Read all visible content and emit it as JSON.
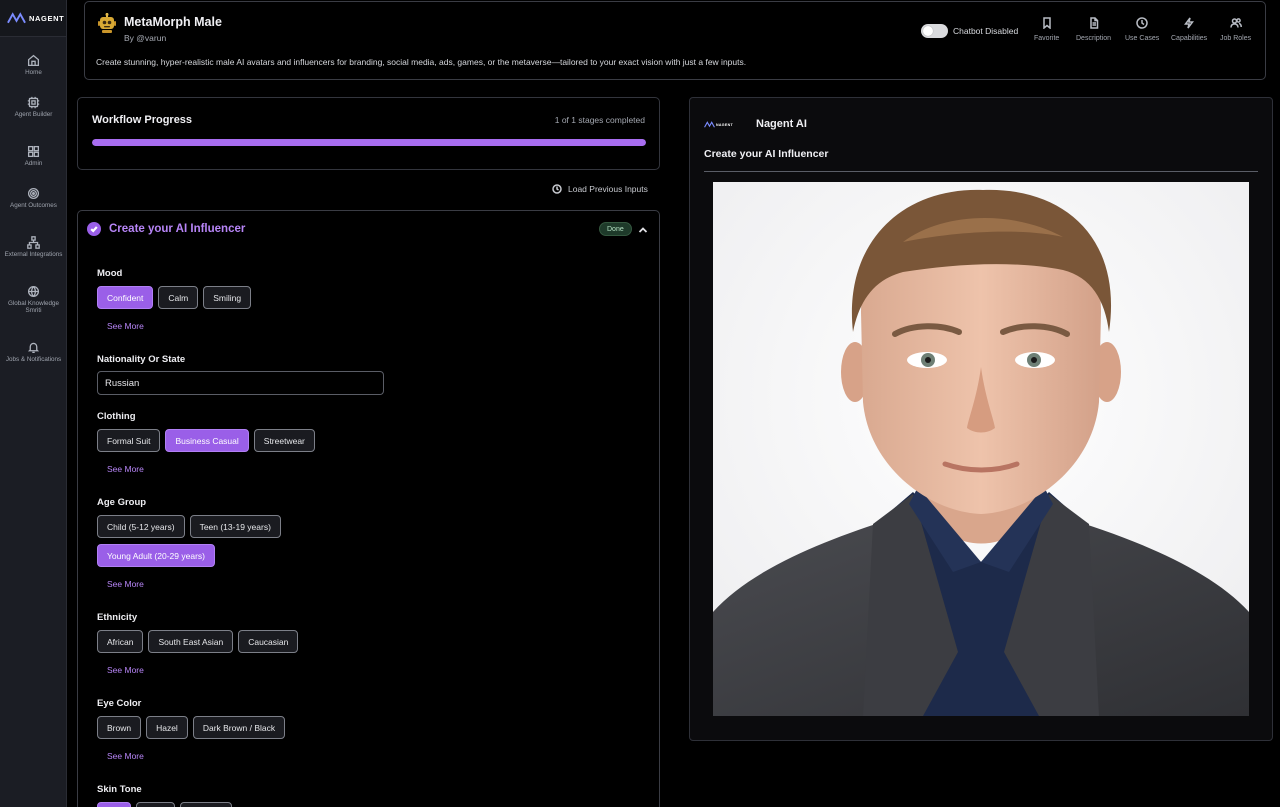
{
  "brand": {
    "name": "NAGENT"
  },
  "sidebar": {
    "items": [
      {
        "label": "Home",
        "icon": "home-icon"
      },
      {
        "label": "Agent Builder",
        "icon": "chip-icon"
      },
      {
        "label": "Admin",
        "icon": "grid-icon"
      },
      {
        "label": "Agent Outcomes",
        "icon": "target-icon"
      },
      {
        "label": "External Integrations",
        "icon": "network-icon"
      },
      {
        "label": "Global Knowledge Smriti",
        "icon": "knowledge-icon"
      },
      {
        "label": "Jobs & Notifications",
        "icon": "bell-icon"
      }
    ]
  },
  "header": {
    "title": "MetaMorph Male",
    "by": "By @varun",
    "description": "Create stunning, hyper-realistic male AI avatars and influencers for branding, social media, ads, games, or the metaverse—tailored to your exact vision with just a few inputs.",
    "chatbot_label": "Chatbot Disabled",
    "chatbot_enabled": false,
    "actions": [
      {
        "label": "Favorite",
        "icon": "bookmark-icon"
      },
      {
        "label": "Description",
        "icon": "document-icon"
      },
      {
        "label": "Use Cases",
        "icon": "clock-icon"
      },
      {
        "label": "Capabilities",
        "icon": "bolt-icon"
      },
      {
        "label": "Job Roles",
        "icon": "users-icon"
      }
    ]
  },
  "workflow": {
    "title": "Workflow Progress",
    "count_text": "1 of 1 stages completed",
    "progress": 1.0
  },
  "load_previous_label": "Load Previous Inputs",
  "stage": {
    "title": "Create your AI Influencer",
    "status": "Done"
  },
  "form": {
    "see_more": "See More",
    "mood": {
      "label": "Mood",
      "options": [
        "Confident",
        "Calm",
        "Smiling"
      ],
      "selected": "Confident"
    },
    "nationality": {
      "label": "Nationality Or State",
      "value": "Russian"
    },
    "clothing": {
      "label": "Clothing",
      "options": [
        "Formal Suit",
        "Business Casual",
        "Streetwear"
      ],
      "selected": "Business Casual"
    },
    "age_group": {
      "label": "Age Group",
      "options": [
        "Child (5-12 years)",
        "Teen (13-19 years)",
        "Young Adult (20-29 years)"
      ],
      "selected": "Young Adult (20-29 years)"
    },
    "ethnicity": {
      "label": "Ethnicity",
      "options": [
        "African",
        "South East Asian",
        "Caucasian"
      ]
    },
    "eye_color": {
      "label": "Eye Color",
      "options": [
        "Brown",
        "Hazel",
        "Dark Brown / Black"
      ]
    },
    "skin_tone": {
      "label": "Skin Tone"
    }
  },
  "output": {
    "name": "Nagent AI",
    "logo_text": "NAGENT",
    "title": "Create your AI Influencer"
  },
  "colors": {
    "accent": "#9a5fe8",
    "accent_text": "#b785f7",
    "background": "#000000",
    "sidebar": "#1b1d24"
  }
}
